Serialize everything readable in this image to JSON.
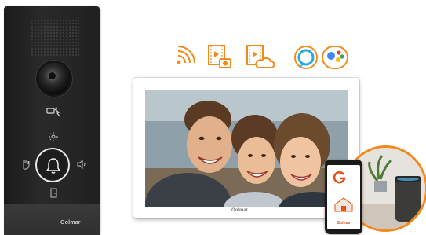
{
  "door_panel": {
    "brand": "Golmar",
    "icons": [
      "camera-lens",
      "rfid-card-icon",
      "light-icon",
      "bell-icon",
      "hand-icon",
      "speaker-icon",
      "door-icon"
    ]
  },
  "feature_icons": [
    "wifi-icon",
    "video-record-icon",
    "cloud-video-icon",
    "alexa-icon",
    "google-assistant-icon"
  ],
  "monitor": {
    "brand": "Golmar",
    "screen_content": "photo"
  },
  "phone": {
    "app_text": "Golmar"
  },
  "colors": {
    "accent": "#f28a1d",
    "alexa": "#27a9e0",
    "google_blue": "#4285f4",
    "google_red": "#ea4335",
    "google_yellow": "#fbbc05",
    "google_green": "#34a853"
  }
}
